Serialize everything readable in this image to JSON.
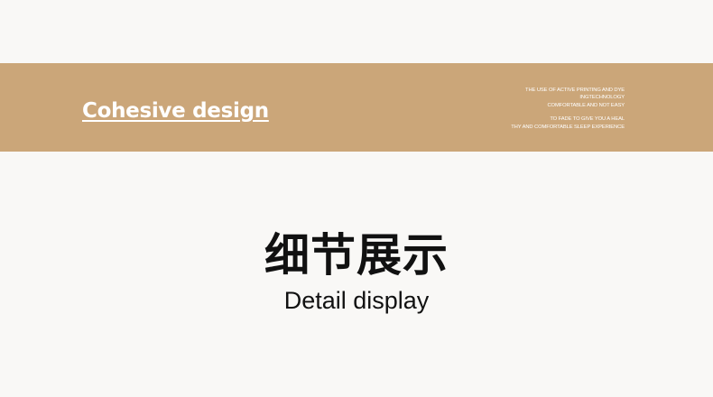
{
  "banner": {
    "title": "Cohesive design",
    "blurb_group_1": [
      "THE USE OF ACTIVE PRINTING AND DYE",
      "INGTECHNOLOGY",
      "COMFORTABLE AND NOT EASY"
    ],
    "blurb_group_2": [
      "TO FADE TO GIVE YOU A HEAL",
      "THY AND COMFORTABLE SLEEP EXPERIENCE"
    ]
  },
  "section": {
    "title_cn": "细节展示",
    "title_en": "Detail display"
  },
  "colors": {
    "background": "#f9f8f6",
    "banner": "#cba679",
    "banner_text": "#ffffff",
    "heading_text": "#111111"
  }
}
